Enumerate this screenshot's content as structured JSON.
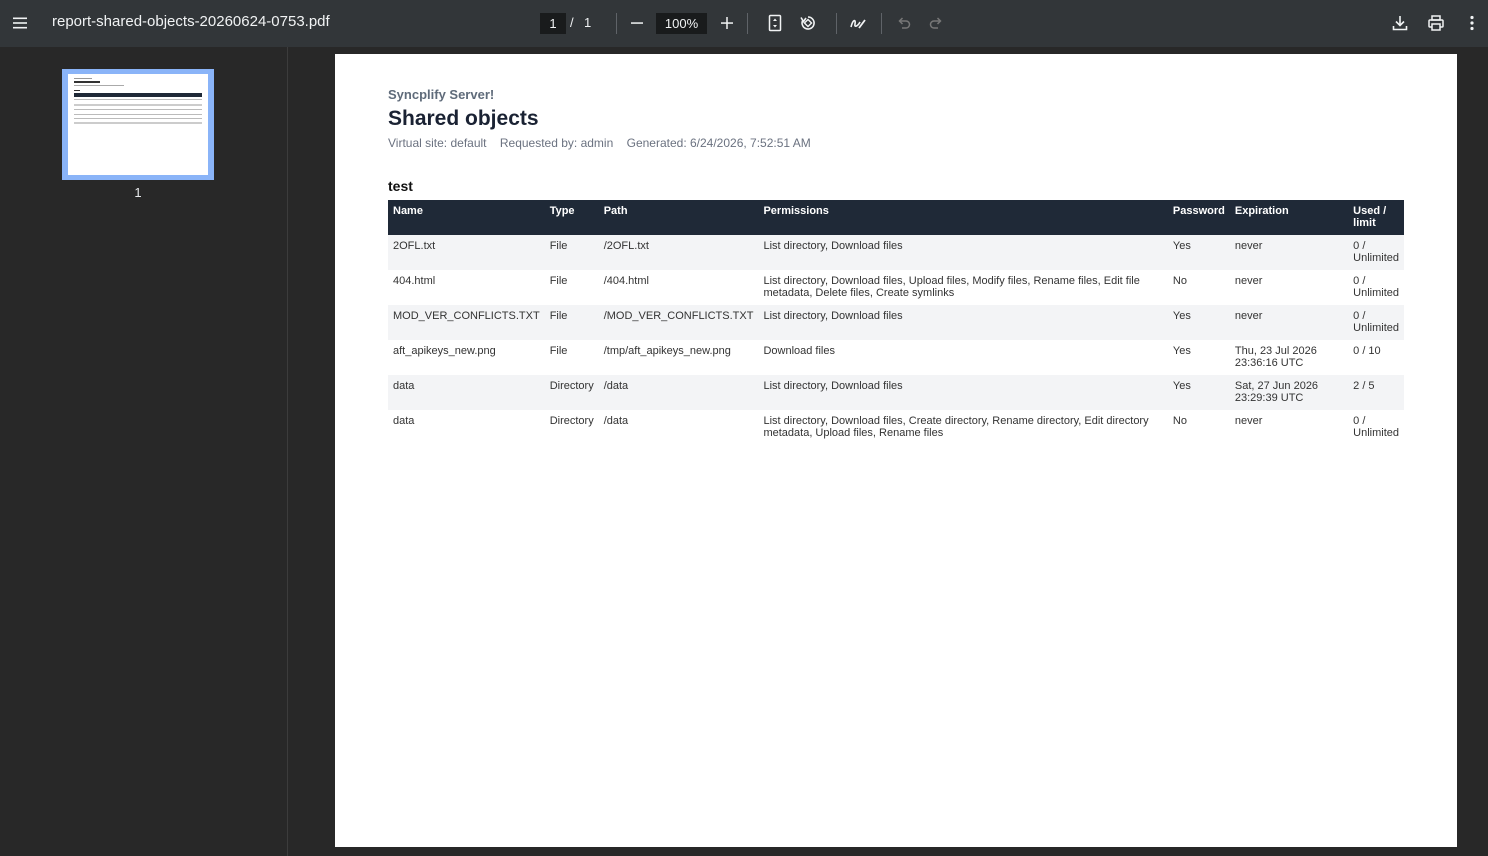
{
  "toolbar": {
    "filename": "report-shared-objects-20260624-0753.pdf",
    "page_current": "1",
    "page_separator": "/",
    "page_total": "1",
    "zoom": "100%"
  },
  "sidebar": {
    "thumbnails": [
      {
        "label": "1"
      }
    ]
  },
  "document": {
    "brand": "Syncplify Server!",
    "title": "Shared objects",
    "meta": {
      "virtual_site": "Virtual site: default",
      "requested_by": "Requested by: admin",
      "generated": "Generated: 6/24/2026, 7:52:51 AM"
    },
    "group_name": "test",
    "table": {
      "headers": {
        "name": "Name",
        "type": "Type",
        "path": "Path",
        "permissions": "Permissions",
        "password": "Password",
        "expiration": "Expiration",
        "used_limit": "Used / limit"
      },
      "rows": [
        {
          "name": "2OFL.txt",
          "type": "File",
          "path": "/2OFL.txt",
          "permissions": "List directory, Download files",
          "password": "Yes",
          "expiration": "never",
          "used_limit": "0 / Unlimited"
        },
        {
          "name": "404.html",
          "type": "File",
          "path": "/404.html",
          "permissions": "List directory, Download files, Upload files, Modify files, Rename files, Edit file metadata, Delete files, Create symlinks",
          "password": "No",
          "expiration": "never",
          "used_limit": "0 / Unlimited"
        },
        {
          "name": "MOD_VER_CONFLICTS.TXT",
          "type": "File",
          "path": "/MOD_VER_CONFLICTS.TXT",
          "permissions": "List directory, Download files",
          "password": "Yes",
          "expiration": "never",
          "used_limit": "0 / Unlimited"
        },
        {
          "name": "aft_apikeys_new.png",
          "type": "File",
          "path": "/tmp/aft_apikeys_new.png",
          "permissions": "Download files",
          "password": "Yes",
          "expiration": "Thu, 23 Jul 2026 23:36:16 UTC",
          "used_limit": "0 / 10"
        },
        {
          "name": "data",
          "type": "Directory",
          "path": "/data",
          "permissions": "List directory, Download files",
          "password": "Yes",
          "expiration": "Sat, 27 Jun 2026 23:29:39 UTC",
          "used_limit": "2 / 5"
        },
        {
          "name": "data",
          "type": "Directory",
          "path": "/data",
          "permissions": "List directory, Download files, Create directory, Rename directory, Edit directory metadata, Upload files, Rename files",
          "password": "No",
          "expiration": "never",
          "used_limit": "0 / Unlimited"
        }
      ]
    }
  }
}
